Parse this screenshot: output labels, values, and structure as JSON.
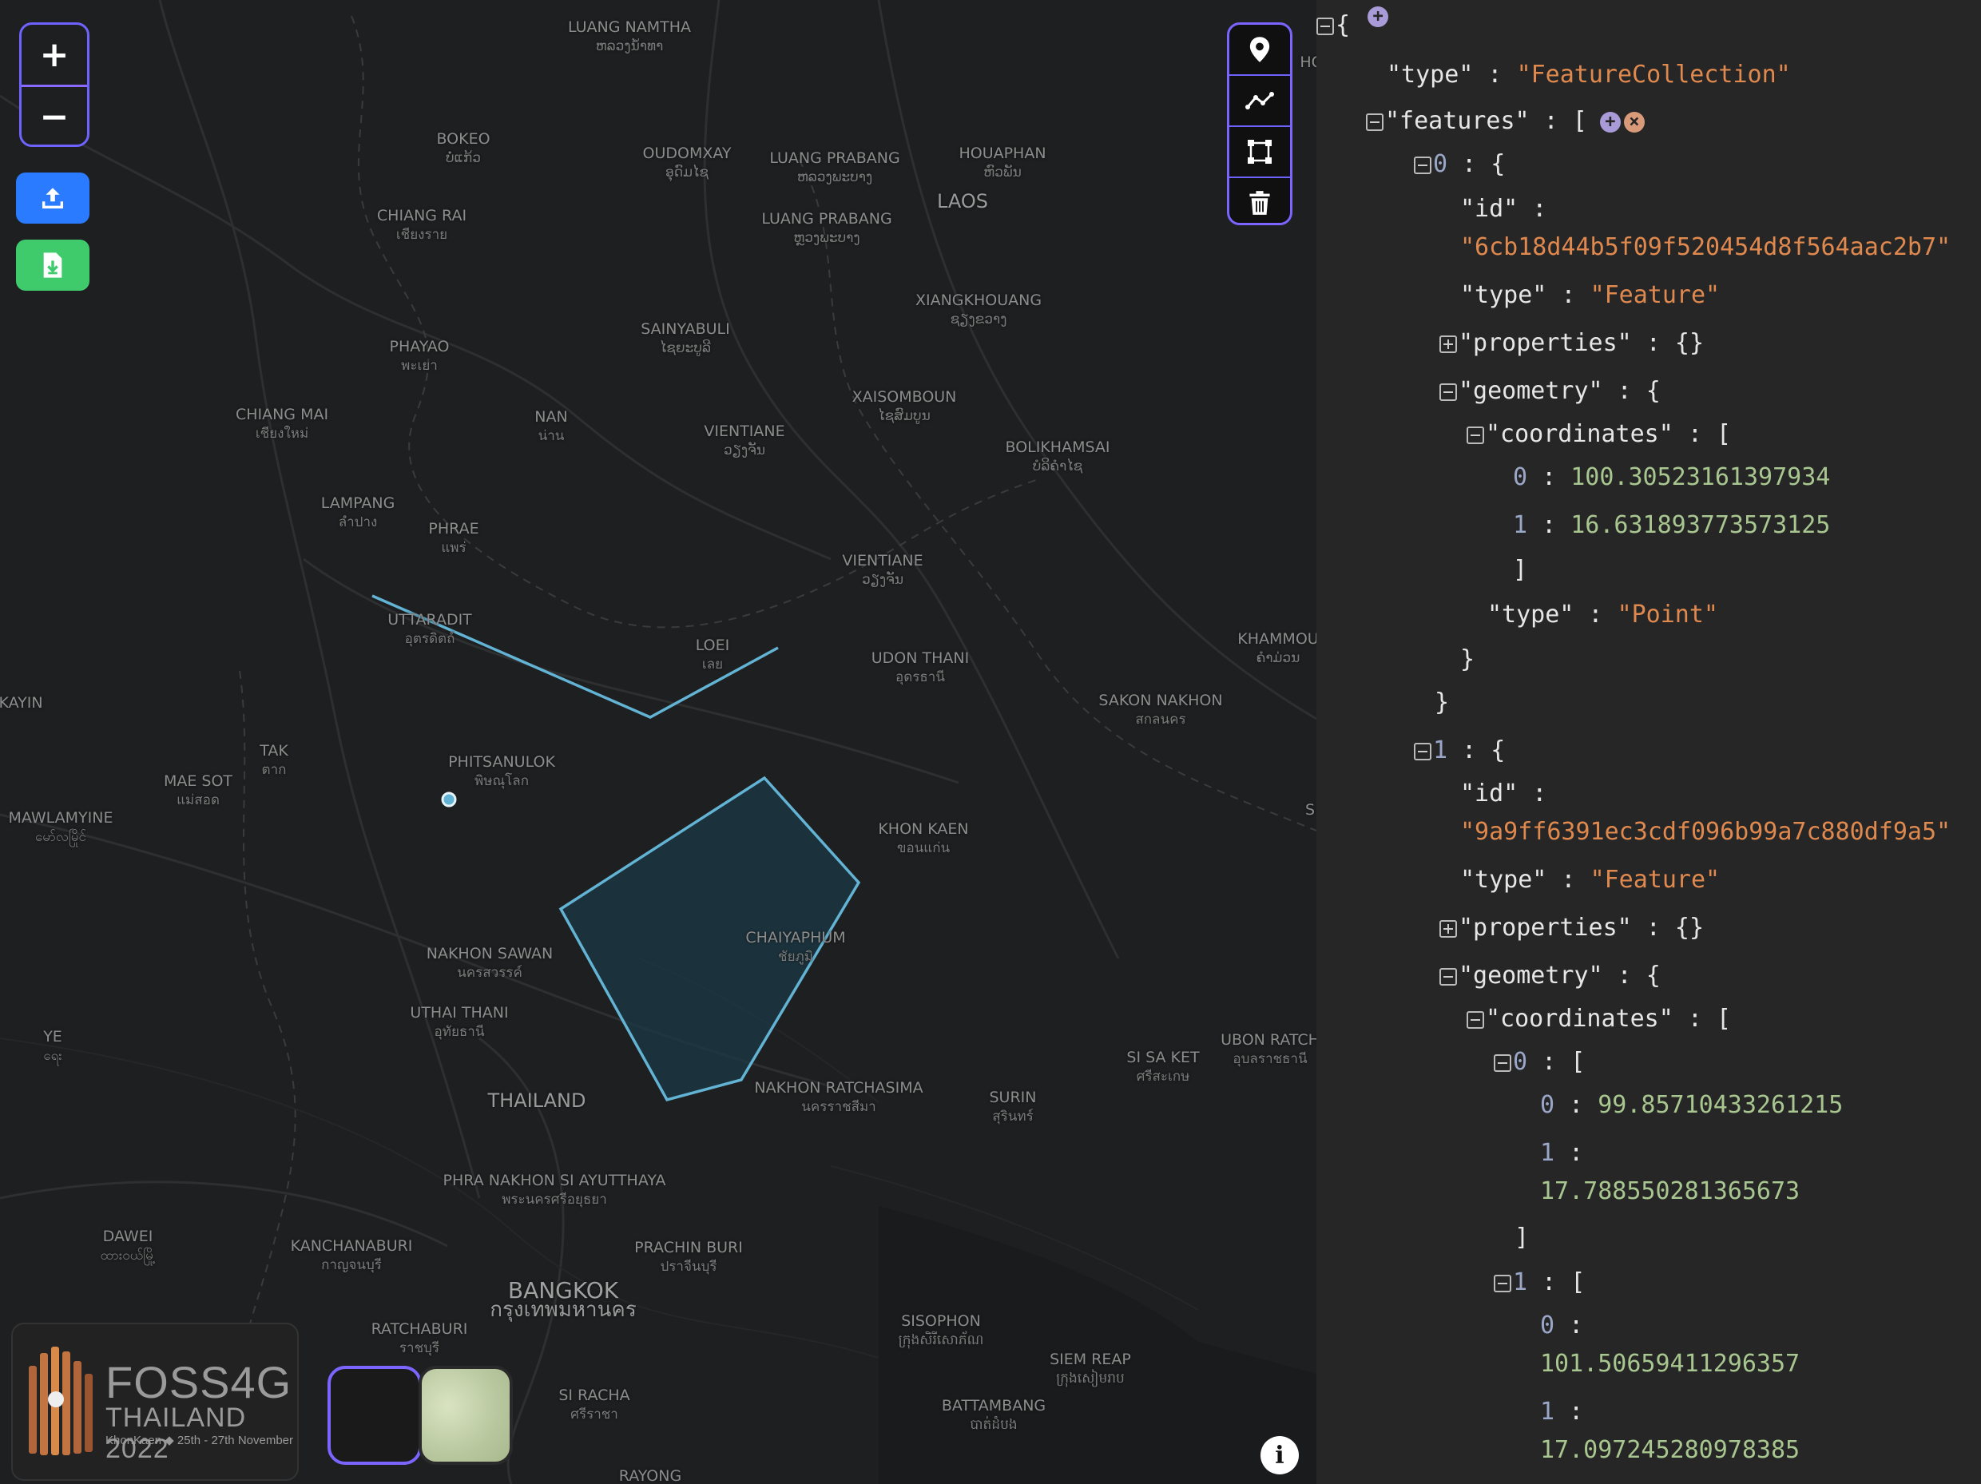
{
  "map": {
    "labels": [
      {
        "name": "LUANG NAMTHA",
        "native": "ຫລວງນ້ຳທາ"
      },
      {
        "name": "BOKEO",
        "native": "ບໍ່ແກ້ວ"
      },
      {
        "name": "OUDOMXAY",
        "native": "ອຸດົມໄຊ"
      },
      {
        "name": "LUANG PRABANG",
        "native": "ຫລວງພະບາງ"
      },
      {
        "name": "HOUAPHAN",
        "native": "ຫົວພັນ"
      },
      {
        "name": "LAOS",
        "native": ""
      },
      {
        "name": "CHIANG RAI",
        "native": "เชียงราย"
      },
      {
        "name": "LUANG PRABANG",
        "native": "ຫຼວງພະບາງ"
      },
      {
        "name": "XIANGKHOUANG",
        "native": "ຊຽງຂວາງ"
      },
      {
        "name": "PHAYAO",
        "native": "พะเยา"
      },
      {
        "name": "SAINYABULI",
        "native": "ໄຊຍະບູລີ"
      },
      {
        "name": "XAISOMBOUN",
        "native": "ໄຊສົມບູນ"
      },
      {
        "name": "CHIANG MAI",
        "native": "เชียงใหม่"
      },
      {
        "name": "NAN",
        "native": "น่าน"
      },
      {
        "name": "VIENTIANE",
        "native": "ວຽງຈັນ"
      },
      {
        "name": "BOLIKHAMSAI",
        "native": "ບໍລິຄໍາໄຊ"
      },
      {
        "name": "LAMPANG",
        "native": "ลำปาง"
      },
      {
        "name": "PHRAE",
        "native": "แพร่"
      },
      {
        "name": "VIENTIANE",
        "native": "ວຽງຈັນ"
      },
      {
        "name": "UTTARADIT",
        "native": "อุตรดิตถ์"
      },
      {
        "name": "LOEI",
        "native": "เลย"
      },
      {
        "name": "UDON THANI",
        "native": "อุดรธานี"
      },
      {
        "name": "KHAMMOU",
        "native": "ຄຳມ່ວນ"
      },
      {
        "name": "KAYIN",
        "native": ""
      },
      {
        "name": "SAKON NAKHON",
        "native": "สกลนคร"
      },
      {
        "name": "TAK",
        "native": "ตาก"
      },
      {
        "name": "PHITSANULOK",
        "native": "พิษณุโลก"
      },
      {
        "name": "MAE SOT",
        "native": "แม่สอด"
      },
      {
        "name": "MAWLAMYINE",
        "native": "မော်လမြိုင်"
      },
      {
        "name": "KHON KAEN",
        "native": "ขอนแก่น"
      },
      {
        "name": "CHAIYAPHUM",
        "native": "ชัยภูมิ"
      },
      {
        "name": "NAKHON SAWAN",
        "native": "นครสวรรค์"
      },
      {
        "name": "UTHAI THANI",
        "native": "อุทัยธานี"
      },
      {
        "name": "YE",
        "native": "ရေး"
      },
      {
        "name": "SI SA KET",
        "native": "ศรีสะเกษ"
      },
      {
        "name": "UBON RATCH",
        "native": "อุบลราชธานี"
      },
      {
        "name": "NAKHON RATCHASIMA",
        "native": "นครราชสีมา"
      },
      {
        "name": "SURIN",
        "native": "สุรินทร์"
      },
      {
        "name": "THAILAND",
        "native": ""
      },
      {
        "name": "PHRA NAKHON SI AYUTTHAYA",
        "native": "พระนครศรีอยุธยา"
      },
      {
        "name": "DAWEI",
        "native": "ထားဝယ်မြို့"
      },
      {
        "name": "KANCHANABURI",
        "native": "กาญจนบุรี"
      },
      {
        "name": "PRACHIN BURI",
        "native": "ปราจีนบุรี"
      },
      {
        "name": "BANGKOK",
        "native": "กรุงเทพมหานคร"
      },
      {
        "name": "SISOPHON",
        "native": "ក្រុងសិរីសោភ័ណ"
      },
      {
        "name": "RATCHABURI",
        "native": "ราชบุรี"
      },
      {
        "name": "SIEM REAP",
        "native": "ក្រុងសៀមរាប"
      },
      {
        "name": "SI RACHA",
        "native": "ศรีราชา"
      },
      {
        "name": "BATTAMBANG",
        "native": "បាត់ដំបង"
      },
      {
        "name": "RAYONG",
        "native": ""
      },
      {
        "name": "HO",
        "native": ""
      },
      {
        "name": "S",
        "native": ""
      }
    ],
    "features": {
      "line_color": "#62b3d4",
      "polygon_fill": "#1b3a46"
    }
  },
  "controls": {
    "zoom_in": "+",
    "zoom_out": "−",
    "upload_icon": "upload-icon",
    "download_icon": "download-icon",
    "draw_tools": [
      "point-icon",
      "line-icon",
      "polygon-icon",
      "trash-icon"
    ],
    "info": "i"
  },
  "logo": {
    "main": "FOSS4G",
    "sub": "THAILAND 2022",
    "tag": "KhonKaen ◆ 25th - 27th November"
  },
  "json_view": {
    "lines": [
      {
        "tog": "minus",
        "parts": [
          [
            "jp",
            "{"
          ]
        ],
        "extra": "add"
      },
      {
        "parts": [
          [
            "jk",
            "\"type\""
          ],
          [
            "jp",
            " : "
          ],
          [
            "js",
            "\"FeatureCollection\""
          ]
        ]
      },
      {
        "tog": "minus",
        "parts": [
          [
            "jk",
            "\"features\""
          ],
          [
            "jp",
            " : ["
          ]
        ],
        "extra": "adddel"
      },
      {
        "tog": "minus",
        "parts": [
          [
            "idx",
            "0"
          ],
          [
            "jp",
            " : {"
          ]
        ]
      },
      {
        "parts": [
          [
            "jk",
            "\"id\""
          ],
          [
            "jp",
            " :"
          ]
        ]
      },
      {
        "parts": [
          [
            "js",
            "\"6cb18d44b5f09f520454d8f564aac2b7\""
          ]
        ]
      },
      {
        "parts": [
          [
            "jk",
            "\"type\""
          ],
          [
            "jp",
            " : "
          ],
          [
            "js",
            "\"Feature\""
          ]
        ]
      },
      {
        "tog": "plus",
        "parts": [
          [
            "jk",
            "\"properties\""
          ],
          [
            "jp",
            " : {}"
          ]
        ]
      },
      {
        "tog": "minus",
        "parts": [
          [
            "jk",
            "\"geometry\""
          ],
          [
            "jp",
            " : {"
          ]
        ]
      },
      {
        "tog": "minus",
        "parts": [
          [
            "jk",
            "\"coordinates\""
          ],
          [
            "jp",
            " : ["
          ]
        ]
      },
      {
        "parts": [
          [
            "idx",
            "0"
          ],
          [
            "jp",
            " : "
          ],
          [
            "jn",
            "100.30523161397934"
          ]
        ]
      },
      {
        "parts": [
          [
            "idx",
            "1"
          ],
          [
            "jp",
            " : "
          ],
          [
            "jn",
            "16.631893773573125"
          ]
        ]
      },
      {
        "parts": [
          [
            "jp",
            "]"
          ]
        ]
      },
      {
        "parts": [
          [
            "jk",
            "\"type\""
          ],
          [
            "jp",
            " : "
          ],
          [
            "js",
            "\"Point\""
          ]
        ]
      },
      {
        "parts": [
          [
            "jp",
            "}"
          ]
        ]
      },
      {
        "parts": [
          [
            "jp",
            "}"
          ]
        ]
      },
      {
        "tog": "minus",
        "parts": [
          [
            "idx",
            "1"
          ],
          [
            "jp",
            " : {"
          ]
        ]
      },
      {
        "parts": [
          [
            "jk",
            "\"id\""
          ],
          [
            "jp",
            " :"
          ]
        ]
      },
      {
        "parts": [
          [
            "js",
            "\"9a9ff6391ec3cdf096b99a7c880df9a5\""
          ]
        ]
      },
      {
        "parts": [
          [
            "jk",
            "\"type\""
          ],
          [
            "jp",
            " : "
          ],
          [
            "js",
            "\"Feature\""
          ]
        ]
      },
      {
        "tog": "plus",
        "parts": [
          [
            "jk",
            "\"properties\""
          ],
          [
            "jp",
            " : {}"
          ]
        ]
      },
      {
        "tog": "minus",
        "parts": [
          [
            "jk",
            "\"geometry\""
          ],
          [
            "jp",
            " : {"
          ]
        ]
      },
      {
        "tog": "minus",
        "parts": [
          [
            "jk",
            "\"coordinates\""
          ],
          [
            "jp",
            " : ["
          ]
        ]
      },
      {
        "tog": "minus",
        "parts": [
          [
            "idx",
            "0"
          ],
          [
            "jp",
            " : ["
          ]
        ]
      },
      {
        "parts": [
          [
            "idx",
            "0"
          ],
          [
            "jp",
            " : "
          ],
          [
            "jn",
            "99.85710433261215"
          ]
        ]
      },
      {
        "parts": [
          [
            "idx",
            "1"
          ],
          [
            "jp",
            " :"
          ]
        ]
      },
      {
        "parts": [
          [
            "jn",
            "17.788550281365673"
          ]
        ]
      },
      {
        "parts": [
          [
            "jp",
            "]"
          ]
        ]
      },
      {
        "tog": "minus",
        "parts": [
          [
            "idx",
            "1"
          ],
          [
            "jp",
            " : ["
          ]
        ]
      },
      {
        "parts": [
          [
            "idx",
            "0"
          ],
          [
            "jp",
            " :"
          ]
        ]
      },
      {
        "parts": [
          [
            "jn",
            "101.50659411296357"
          ]
        ]
      },
      {
        "parts": [
          [
            "idx",
            "1"
          ],
          [
            "jp",
            " :"
          ]
        ]
      },
      {
        "parts": [
          [
            "jn",
            "17.097245280978385"
          ]
        ]
      }
    ]
  }
}
